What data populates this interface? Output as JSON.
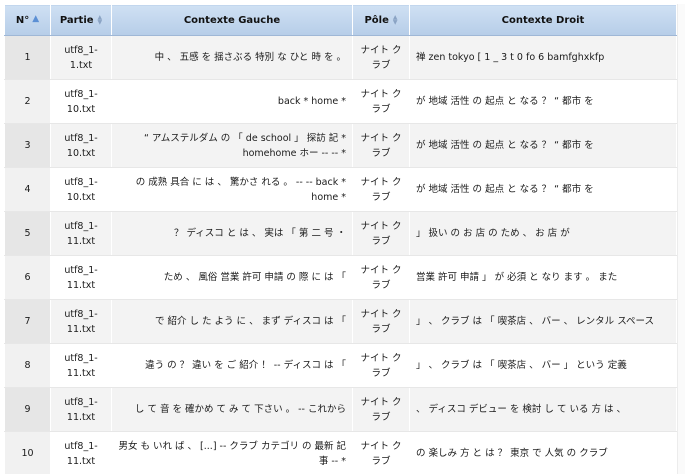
{
  "columns": {
    "no": "N°",
    "partie": "Partie",
    "left": "Contexte Gauche",
    "pole": "Pôle",
    "right": "Contexte Droit"
  },
  "sort_indicator": "▲",
  "rows": [
    {
      "no": "1",
      "partie": "utf8_1-1.txt",
      "left": "中 、 五感 を 揺さぶる 特別 な ひと 時 を 。",
      "pole": "ナイト クラブ",
      "right": "禅 zen tokyo [ 1 _ 3 t 0 fo 6 bamfghxkfp"
    },
    {
      "no": "2",
      "partie": "utf8_1-10.txt",
      "left": "back * home *",
      "pole": "ナイト クラブ",
      "right": "が 地域 活性 の 起点 と なる ？ “ 都市 を"
    },
    {
      "no": "3",
      "partie": "utf8_1-10.txt",
      "left": "“ アムステルダム の 「 de school 」 探訪 記 * homehome ホー -- -- *",
      "pole": "ナイト クラブ",
      "right": "が 地域 活性 の 起点 と なる ？ “ 都市 を"
    },
    {
      "no": "4",
      "partie": "utf8_1-10.txt",
      "left": "の 成熟 具合 に は 、 驚かさ れる 。 -- -- back * home *",
      "pole": "ナイト クラブ",
      "right": "が 地域 活性 の 起点 と なる ？ “ 都市 を"
    },
    {
      "no": "5",
      "partie": "utf8_1-11.txt",
      "left": "？ ディスコ と は 、 実は 「 第 二 号 ・",
      "pole": "ナイト クラブ",
      "right": "」 扱い の お 店 の ため 、 お 店 が"
    },
    {
      "no": "6",
      "partie": "utf8_1-11.txt",
      "left": "ため 、 風俗 営業 許可 申請 の 際 に は 「",
      "pole": "ナイト クラブ",
      "right": "営業 許可 申請 」 が 必須 と なり ます 。 また"
    },
    {
      "no": "7",
      "partie": "utf8_1-11.txt",
      "left": "で 紹介 し た よう に 、 まず ディスコ は 「",
      "pole": "ナイト クラブ",
      "right": "」 、 クラブ は 「 喫茶店 、 バー 、 レンタル スペース"
    },
    {
      "no": "8",
      "partie": "utf8_1-11.txt",
      "left": "違う の ？ 違い を ご 紹介 ！ -- ディスコ は 「",
      "pole": "ナイト クラブ",
      "right": "」 、 クラブ は 「 喫茶店 、 バー 」 という 定義"
    },
    {
      "no": "9",
      "partie": "utf8_1-11.txt",
      "left": "し て 音 を 確かめ て み て 下さい 。 -- これから",
      "pole": "ナイト クラブ",
      "right": "、 ディスコ デビュー を 検討 し て いる 方 は 、"
    },
    {
      "no": "10",
      "partie": "utf8_1-11.txt",
      "left": "男女 も いれ ば 、 [...] -- クラブ カテゴリ の 最新 記事 -- *",
      "pole": "ナイト クラブ",
      "right": "の 楽しみ 方 と は ？ 東京 で 人気 の クラブ"
    }
  ]
}
